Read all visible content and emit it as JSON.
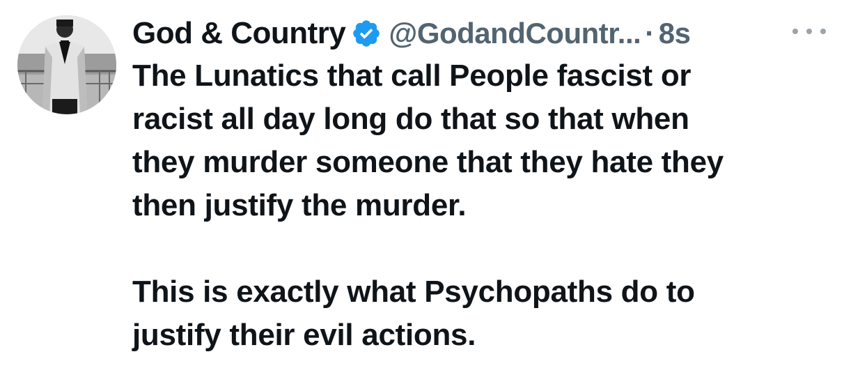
{
  "tweet": {
    "author": {
      "display_name": "God & Country",
      "handle": "@GodandCountr...",
      "verified": true,
      "verified_icon": "verified-badge-icon",
      "avatar_icon": "avatar-photo"
    },
    "separator": "·",
    "timestamp": "8s",
    "more_icon": "more-options-icon",
    "paragraphs": [
      "The Lunatics that call People fascist or\nracist all day long do that so that when\nthey murder someone that they hate they\nthen justify the murder.",
      "This is exactly what Psychopaths do to\njustify their evil actions."
    ]
  },
  "colors": {
    "text_primary": "#0f1419",
    "text_secondary": "#536471",
    "verified_blue": "#1d9bf0",
    "background": "#ffffff"
  }
}
